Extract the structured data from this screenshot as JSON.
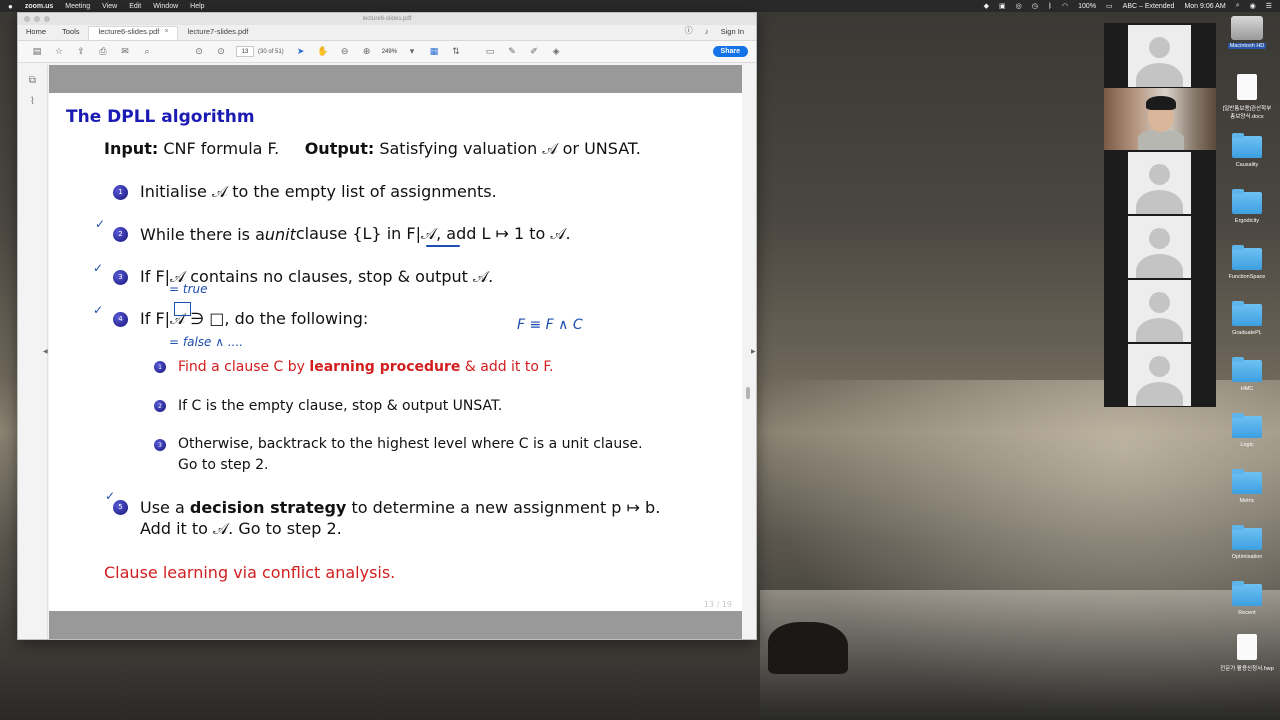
{
  "menubar": {
    "app": "zoom.us",
    "menus": [
      "Meeting",
      "View",
      "Edit",
      "Window",
      "Help"
    ],
    "battery": "100%",
    "input_source": "ABC – Extended",
    "clock": "Mon 9:06 AM"
  },
  "window": {
    "title": "lecture6-slides.pdf",
    "nav": [
      "Home",
      "Tools"
    ],
    "tabs": [
      {
        "label": "lecture6-slides.pdf",
        "close": "×"
      },
      {
        "label": "lecture7-slides.pdf"
      }
    ],
    "signin": "Sign In",
    "page_input": "13",
    "page_of": "(30 of 51)",
    "zoom": "249%",
    "share": "Share"
  },
  "slide": {
    "title": "The DPLL algorithm",
    "input_label": "Input:",
    "input_text": "CNF formula F.",
    "output_label": "Output:",
    "output_text": "Satisfying valuation 𝒜 or UNSAT.",
    "steps": [
      {
        "n": "1",
        "text": "Initialise 𝒜 to the empty list of assignments."
      },
      {
        "n": "2",
        "text_pre": "While there is a ",
        "text_em": "unit",
        "text_post": " clause {L} in F|𝒜, add L ↦ 1 to 𝒜."
      },
      {
        "n": "3",
        "text": "If F|𝒜 contains no clauses, stop & output 𝒜."
      },
      {
        "n": "4",
        "text": "If F|𝒜 ∋ □, do the following:"
      },
      {
        "n": "5",
        "text_pre": "Use a ",
        "text_bold": "decision strategy",
        "text_post": " to determine a new assignment p ↦ b.",
        "line2": "Add it to 𝒜. Go to step 2."
      }
    ],
    "substeps": [
      {
        "n": "1",
        "pre": "Find a clause C by ",
        "bold": "learning procedure",
        "post": " & add it to F."
      },
      {
        "n": "2",
        "text": "If C is the empty clause, stop & output UNSAT."
      },
      {
        "n": "3",
        "text": "Otherwise, backtrack to the highest level where C is a unit clause.",
        "line2": "Go to step 2."
      }
    ],
    "footer": "Clause learning via conflict analysis.",
    "page": "13 / 19"
  },
  "annotations": {
    "true_note": "= true",
    "false_note": "= false ∧ ....",
    "formula_note": "F ≡ F ∧ C"
  },
  "desktop_icons": [
    {
      "label": "Macintosh HD"
    },
    {
      "label": "[일반통보용]관산학부 총보양식.docx"
    },
    {
      "label": "Causality"
    },
    {
      "label": "Ergodicity"
    },
    {
      "label": "FunctionSpace"
    },
    {
      "label": "GraduatePL"
    },
    {
      "label": "HMC"
    },
    {
      "label": "Logic"
    },
    {
      "label": "Metric"
    },
    {
      "label": "Optimisation"
    },
    {
      "label": "Recent"
    },
    {
      "label": "전문가 활용신청서.hwp"
    }
  ]
}
